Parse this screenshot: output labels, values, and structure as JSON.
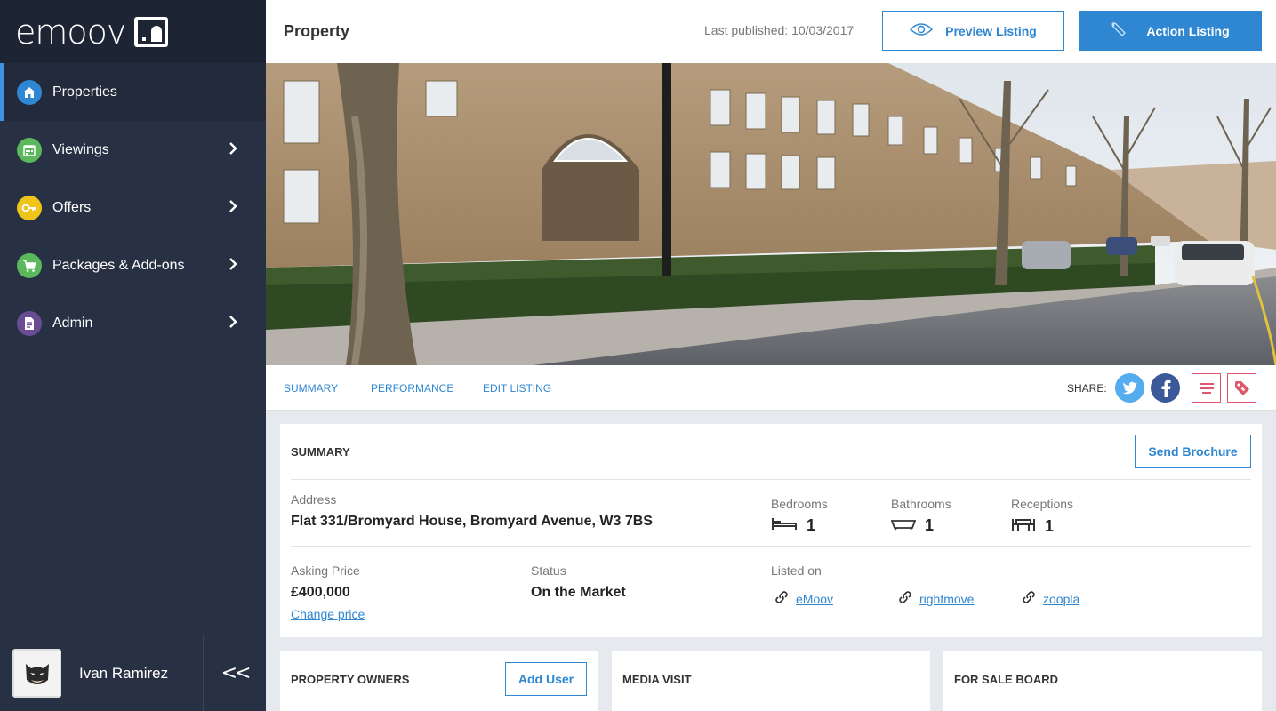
{
  "brand": {
    "logo_text": "emoov"
  },
  "sidebar": {
    "items": [
      {
        "label": "Properties",
        "icon": "home-icon",
        "color": "#2f86d1"
      },
      {
        "label": "Viewings",
        "icon": "calendar-icon",
        "color": "#5cb85c"
      },
      {
        "label": "Offers",
        "icon": "key-icon",
        "color": "#f0c419"
      },
      {
        "label": "Packages & Add-ons",
        "icon": "cart-icon",
        "color": "#5cb85c"
      },
      {
        "label": "Admin",
        "icon": "document-icon",
        "color": "#6a4c93"
      }
    ],
    "user": {
      "name": "Ivan Ramirez"
    },
    "collapse_label": "<<"
  },
  "header": {
    "title": "Property",
    "last_published": "Last published: 10/03/2017",
    "preview_label": "Preview Listing",
    "action_label": "Action Listing"
  },
  "tabs": {
    "items": [
      "SUMMARY",
      "PERFORMANCE",
      "EDIT LISTING"
    ],
    "share_label": "SHARE:"
  },
  "summary": {
    "title": "SUMMARY",
    "send_brochure": "Send Brochure",
    "address_label": "Address",
    "address": "Flat 331/Bromyard House, Bromyard Avenue, W3 7BS",
    "bedrooms_label": "Bedrooms",
    "bedrooms": "1",
    "bathrooms_label": "Bathrooms",
    "bathrooms": "1",
    "receptions_label": "Receptions",
    "receptions": "1",
    "asking_price_label": "Asking Price",
    "asking_price": "£400,000",
    "change_price": "Change price",
    "status_label": "Status",
    "status": "On the Market",
    "listed_on_label": "Listed on",
    "listed_on": [
      "eMoov",
      "rightmove",
      "zoopla"
    ]
  },
  "cards": {
    "owners_title": "PROPERTY OWNERS",
    "add_user": "Add User",
    "media_title": "MEDIA VISIT",
    "board_title": "FOR SALE BOARD"
  },
  "colors": {
    "accent": "#2f86d1",
    "sidebar_bg": "#283144",
    "twitter": "#55acee",
    "facebook": "#3b5998",
    "share_outline": "#e0566b"
  }
}
